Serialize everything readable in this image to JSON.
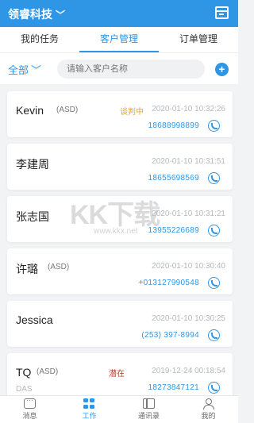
{
  "header": {
    "title": "领睿科技"
  },
  "tabs": [
    "我的任务",
    "客户管理",
    "订单管理"
  ],
  "filter": {
    "scope": "全部",
    "search_placeholder": "请输入客户名称"
  },
  "customers": [
    {
      "name": "Kevin",
      "tag": "(ASD)",
      "status": "谈判中",
      "status_color": "#e6a23c",
      "date": "2020-01-10 10:32:26",
      "phone": "18688998899"
    },
    {
      "name": "李建周",
      "tag": "",
      "status": "",
      "status_color": "",
      "date": "2020-01-10 10:31:51",
      "phone": "18655698569"
    },
    {
      "name": "张志国",
      "tag": "",
      "status": "",
      "status_color": "",
      "date": "2020-01-10 10:31:21",
      "phone": "13955226689"
    },
    {
      "name": "许璐",
      "tag": "(ASD)",
      "status": "",
      "status_color": "",
      "date": "2020-01-10 10:30:40",
      "phone": "+013127990548"
    },
    {
      "name": "Jessica",
      "tag": "",
      "status": "",
      "status_color": "",
      "date": "2020-01-10 10:30:25",
      "phone": "(253) 397-8994"
    },
    {
      "name": "TQ",
      "tag": "(ASD)",
      "status": "潜在",
      "status_color": "#c0392b",
      "date": "2019-12-24 00:18:54",
      "phone": "18273847121",
      "sub": "DAS"
    }
  ],
  "watermark": {
    "text": "KK下载",
    "url": "www.kkx.net"
  },
  "bottom_nav": [
    {
      "label": "消息",
      "icon": "message-icon"
    },
    {
      "label": "工作",
      "icon": "grid-icon"
    },
    {
      "label": "通讯录",
      "icon": "contacts-icon"
    },
    {
      "label": "我的",
      "icon": "user-icon"
    }
  ],
  "colors": {
    "accent": "#2f96e6"
  }
}
